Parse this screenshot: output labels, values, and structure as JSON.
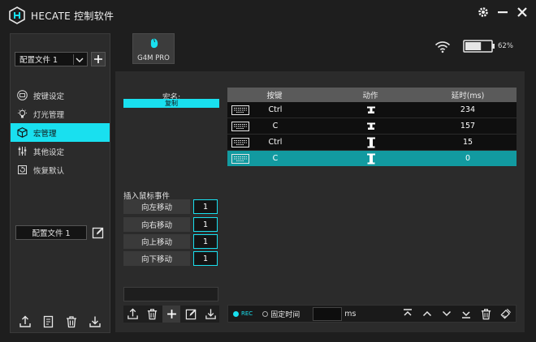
{
  "app": {
    "title": "HECATE 控制软件"
  },
  "profile": {
    "selected": "配置文件 1",
    "name": "配置文件 1"
  },
  "nav": [
    {
      "label": "按键设定",
      "icon": "keyboard-icon",
      "active": false
    },
    {
      "label": "灯光管理",
      "icon": "bulb-icon",
      "active": false
    },
    {
      "label": "宏管理",
      "icon": "macro-icon",
      "active": true
    },
    {
      "label": "其他设定",
      "icon": "sliders-icon",
      "active": false
    },
    {
      "label": "恢复默认",
      "icon": "restore-icon",
      "active": false
    }
  ],
  "device": {
    "label": "G4M PRO"
  },
  "battery": {
    "percent_text": "62%",
    "level": 0.62
  },
  "macro": {
    "name_label": "宏名:",
    "name_value": "复制"
  },
  "insert": {
    "title": "插入鼠标事件",
    "rows": [
      {
        "label": "向左移动",
        "value": "1"
      },
      {
        "label": "向右移动",
        "value": "1"
      },
      {
        "label": "向上移动",
        "value": "1"
      },
      {
        "label": "向下移动",
        "value": "1"
      }
    ]
  },
  "table": {
    "headers": {
      "key": "按键",
      "action": "动作",
      "delay": "延时(ms)"
    },
    "rows": [
      {
        "key": "Ctrl",
        "action": "up",
        "delay": "234",
        "selected": false
      },
      {
        "key": "C",
        "action": "up",
        "delay": "157",
        "selected": false
      },
      {
        "key": "Ctrl",
        "action": "down",
        "delay": "15",
        "selected": false
      },
      {
        "key": "C",
        "action": "down",
        "delay": "0",
        "selected": true
      }
    ]
  },
  "bottom": {
    "rec_label": "REC",
    "fixed_label": "固定时间",
    "unit": "ms"
  },
  "colors": {
    "accent": "#19e0ef",
    "selected_row": "#129aa0",
    "panel": "#2b2b2b",
    "background": "#1e1e1e"
  }
}
